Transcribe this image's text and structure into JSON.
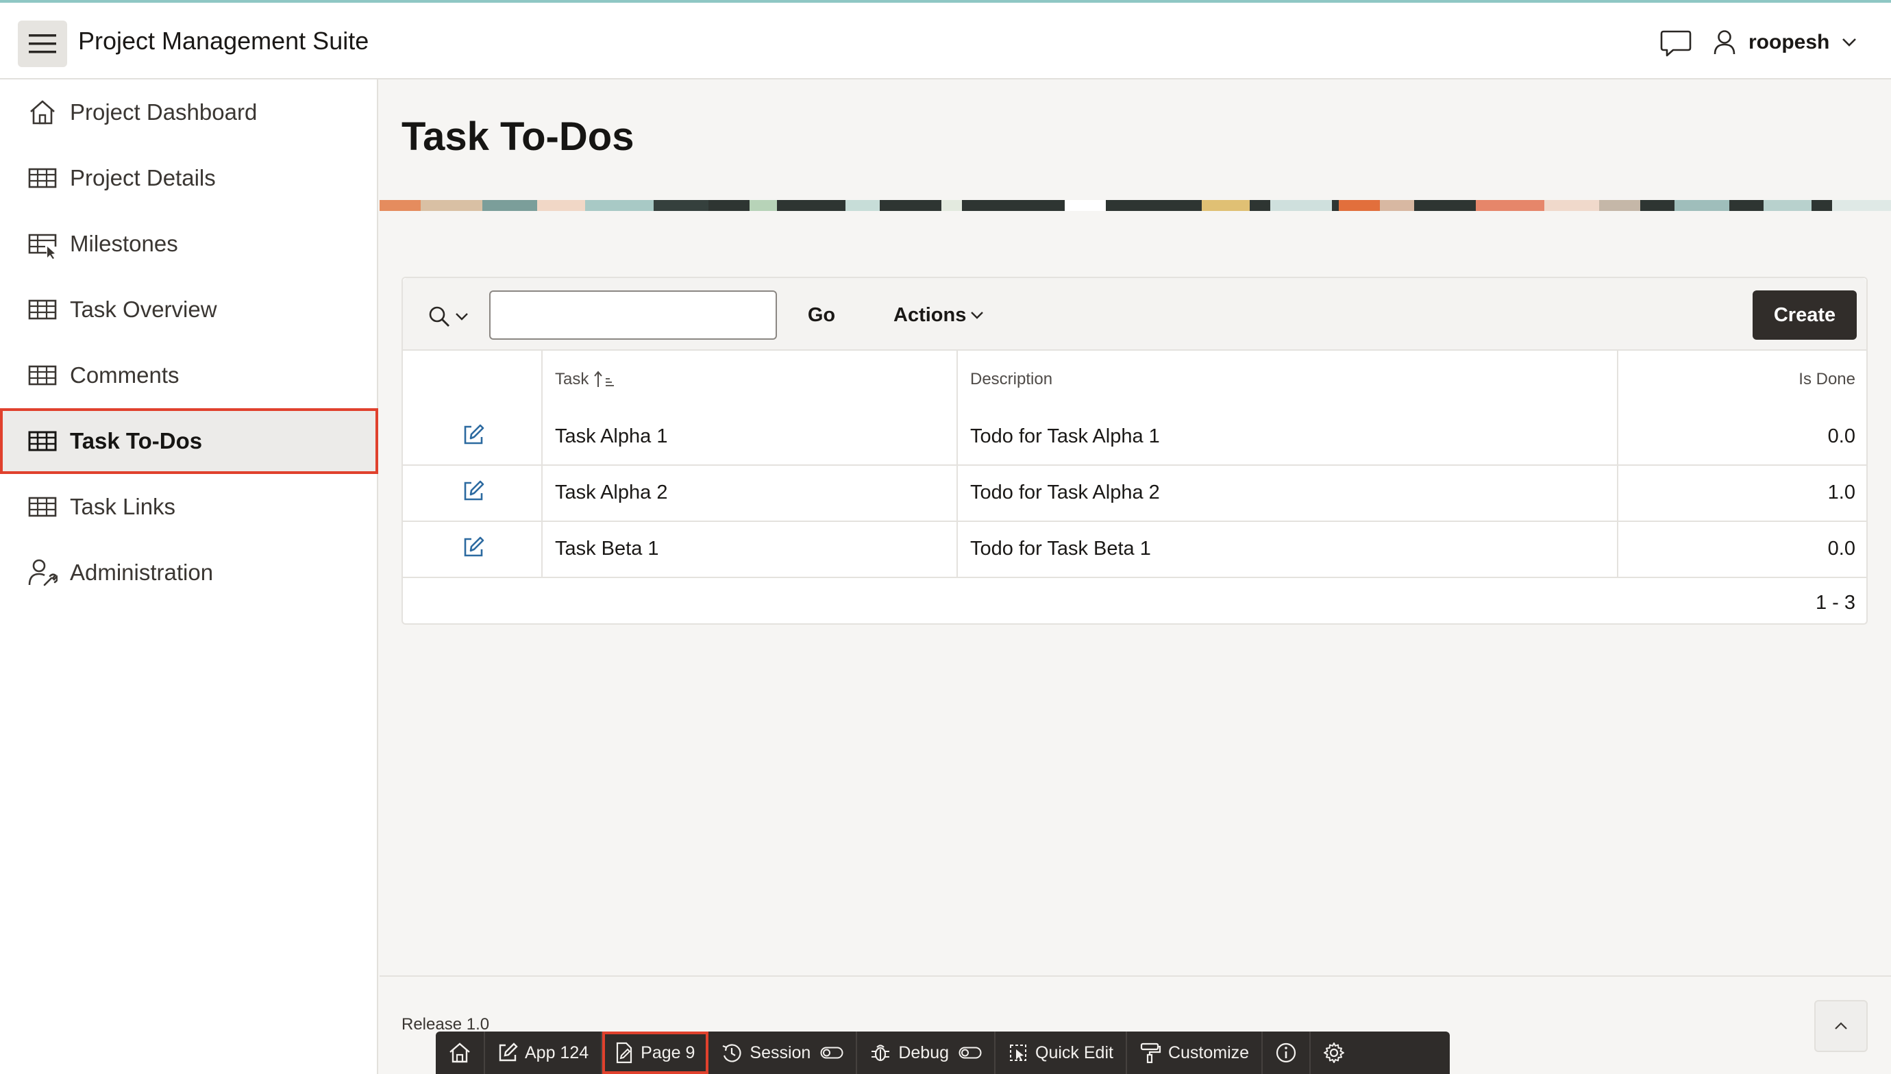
{
  "app": {
    "title": "Project Management Suite",
    "user": "roopesh"
  },
  "sidebar": {
    "items": [
      {
        "label": "Project Dashboard",
        "icon": "home-icon",
        "active": false
      },
      {
        "label": "Project Details",
        "icon": "table-icon",
        "active": false
      },
      {
        "label": "Milestones",
        "icon": "table-cursor-icon",
        "active": false
      },
      {
        "label": "Task Overview",
        "icon": "table-icon",
        "active": false
      },
      {
        "label": "Comments",
        "icon": "table-icon",
        "active": false
      },
      {
        "label": "Task To-Dos",
        "icon": "table-icon",
        "active": true
      },
      {
        "label": "Task Links",
        "icon": "table-icon",
        "active": false
      },
      {
        "label": "Administration",
        "icon": "user-wrench-icon",
        "active": false
      }
    ]
  },
  "page": {
    "title": "Task To-Dos"
  },
  "report": {
    "search_value": "",
    "go_label": "Go",
    "actions_label": "Actions",
    "create_label": "Create",
    "columns": {
      "task": "Task",
      "description": "Description",
      "is_done": "Is Done"
    },
    "sort": {
      "column": "task",
      "direction": "ascending"
    },
    "rows": [
      {
        "task": "Task Alpha 1",
        "description": "Todo for Task Alpha 1",
        "is_done": "0.0"
      },
      {
        "task": "Task Alpha 2",
        "description": "Todo for Task Alpha 2",
        "is_done": "1.0"
      },
      {
        "task": "Task Beta 1",
        "description": "Todo for Task Beta 1",
        "is_done": "0.0"
      }
    ],
    "pagination": "1 - 3"
  },
  "footer": {
    "release": "Release 1.0"
  },
  "devbar": {
    "app": "App 124",
    "page": "Page 9",
    "session": "Session",
    "debug": "Debug",
    "quick_edit": "Quick Edit",
    "customize": "Customize"
  },
  "colors": {
    "accent_dark": "#312d2a",
    "highlight_red": "#e0412d",
    "link_blue": "#2c6aa0"
  }
}
